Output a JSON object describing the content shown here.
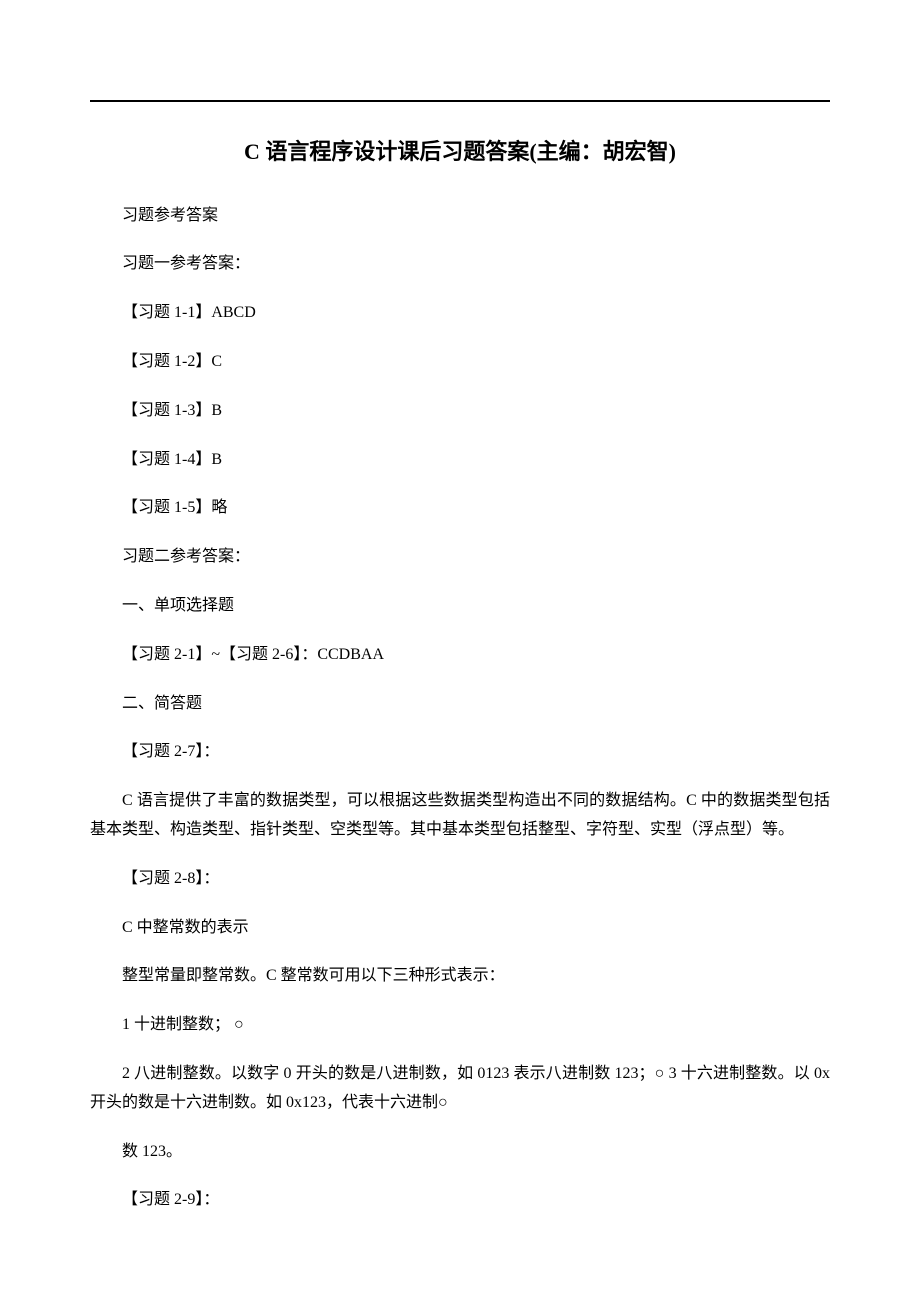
{
  "title": "C 语言程序设计课后习题答案(主编：胡宏智)",
  "sections": {
    "answersLabel": "习题参考答案",
    "section1Header": "习题一参考答案：",
    "q1_1": "【习题 1-1】ABCD",
    "q1_2": "【习题 1-2】C",
    "q1_3": "【习题 1-3】B",
    "q1_4": "【习题 1-4】B",
    "q1_5": "【习题 1-5】略",
    "section2Header": "习题二参考答案：",
    "part1Header": "一、单项选择题",
    "q2_1to6": "【习题 2-1】~【习题 2-6】：CCDBAA",
    "part2Header": "二、简答题",
    "q2_7Label": "【习题 2-7】：",
    "q2_7Body": "C 语言提供了丰富的数据类型，可以根据这些数据类型构造出不同的数据结构。C 中的数据类型包括基本类型、构造类型、指针类型、空类型等。其中基本类型包括整型、字符型、实型（浮点型）等。",
    "q2_8Label": "【习题 2-8】：",
    "q2_8Line1": "C 中整常数的表示",
    "q2_8Line2": "整型常量即整常数。C 整常数可用以下三种形式表示：",
    "q2_8Line3": "1 十进制整数； ○",
    "q2_8Line4": "2 八进制整数。以数字 0 开头的数是八进制数，如 0123 表示八进制数 123；○ 3 十六进制整数。以 0x 开头的数是十六进制数。如 0x123，代表十六进制○",
    "q2_8Line5": "数 123。",
    "q2_9Label": "【习题 2-9】："
  }
}
